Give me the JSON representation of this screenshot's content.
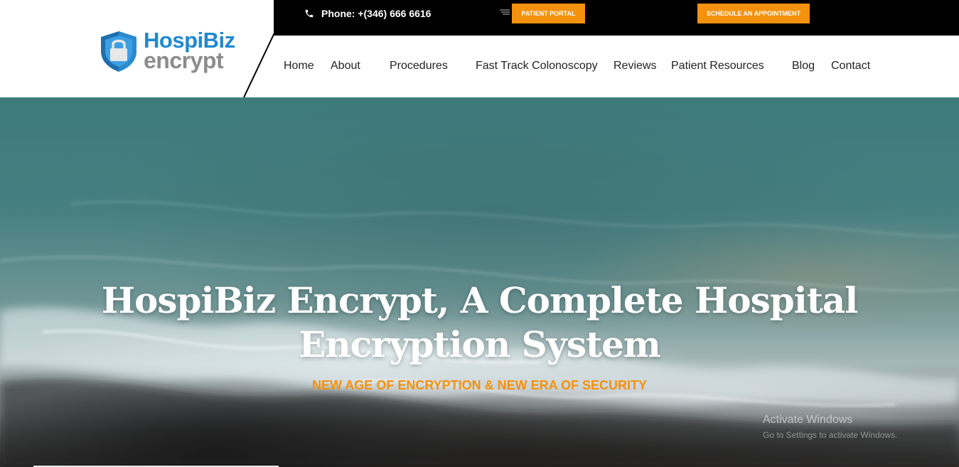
{
  "brand": {
    "name_line1": "HospiBiz",
    "name_line2": "encrypt",
    "color_primary": "#1f89cf",
    "color_secondary": "#8c8c8c"
  },
  "topbar": {
    "phone_text": "Phone: +(346) 666 6616",
    "patient_portal": "PATIENT PORTAL",
    "schedule": "SCHEDULE AN APPOINTMENT",
    "accent": "#f4910d"
  },
  "nav": {
    "items": [
      {
        "label": "Home"
      },
      {
        "label": "About"
      },
      {
        "label": "Procedures"
      },
      {
        "label": "Fast Track Colonoscopy"
      },
      {
        "label": "Reviews"
      },
      {
        "label": "Patient Resources"
      },
      {
        "label": "Blog"
      },
      {
        "label": "Contact"
      }
    ]
  },
  "hero": {
    "title": "HospiBiz Encrypt, A Complete Hospital Encryption System",
    "subtitle": "NEW AGE OF ENCRYPTION & NEW ERA OF SECURITY"
  },
  "watermark": {
    "line1": "Activate Windows",
    "line2": "Go to Settings to activate Windows."
  }
}
